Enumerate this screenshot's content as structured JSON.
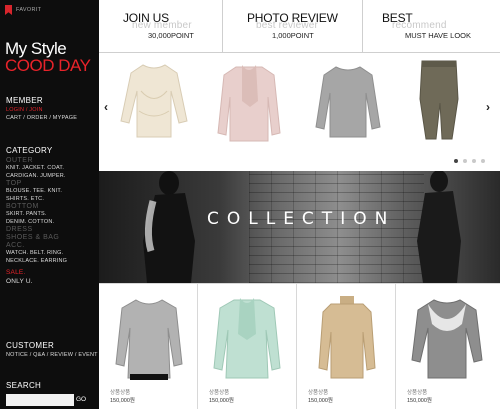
{
  "sidebar": {
    "favorit": "FAVORIT",
    "brand_line1": "My Style",
    "brand_line2": "COOD DAY",
    "member": {
      "title": "MEMBER",
      "line1": "LOGIN / JOIN",
      "line2": "CART / ORDER / MYPAGE"
    },
    "category": {
      "title": "CATEGORY",
      "groups": [
        {
          "name": "OUTER",
          "items": "KNIT. JACKET. COAT.",
          "items2": "CARDIGAN. JUMPER."
        },
        {
          "name": "TOP",
          "items": "BLOUSE. TEE. KNIT.",
          "items2": "SHIRTS. ETC."
        },
        {
          "name": "BOTTOM",
          "items": "SKIRT. PANTS.",
          "items2": "DENIM. COTTON."
        }
      ],
      "dress": "DRESS",
      "shoes": "SHOES & BAG",
      "acc": {
        "name": "ACC.",
        "items": "WATCH. BELT. RING.",
        "items2": "NECKLACE. EARRING"
      },
      "sale": "SALE.",
      "only": "ONLY U."
    },
    "customer": {
      "title": "CUSTOMER",
      "links": "NOTICE / Q&A / REVIEW / EVENT"
    },
    "search": {
      "title": "SEARCH",
      "go": "GO"
    }
  },
  "top_strip": [
    {
      "title": "JOIN US",
      "sub": "new member",
      "value": "30,000POINT"
    },
    {
      "title": "PHOTO REVIEW",
      "sub": "best reviewer",
      "value": "1,000POINT"
    },
    {
      "title": "BEST",
      "sub": "recommend",
      "value": "MUST HAVE LOOK"
    }
  ],
  "slider": {
    "prev": "‹",
    "next": "›",
    "products": [
      "cream-knit-sweater",
      "pink-coat-scarf",
      "grey-sweater",
      "khaki-harem-pants"
    ]
  },
  "banner": {
    "text": "COLLECTION"
  },
  "grid": [
    {
      "name": "상품상품",
      "price": "150,000원",
      "image": "grey-knit-top"
    },
    {
      "name": "상품상품",
      "price": "150,000원",
      "image": "mint-cardigan"
    },
    {
      "name": "상품상품",
      "price": "150,000원",
      "image": "beige-turtleneck"
    },
    {
      "name": "상품상품",
      "price": "150,000원",
      "image": "grey-lace-top"
    }
  ],
  "colors": {
    "sidebar_bg": "#0d0d0d",
    "accent": "#e8232a"
  }
}
